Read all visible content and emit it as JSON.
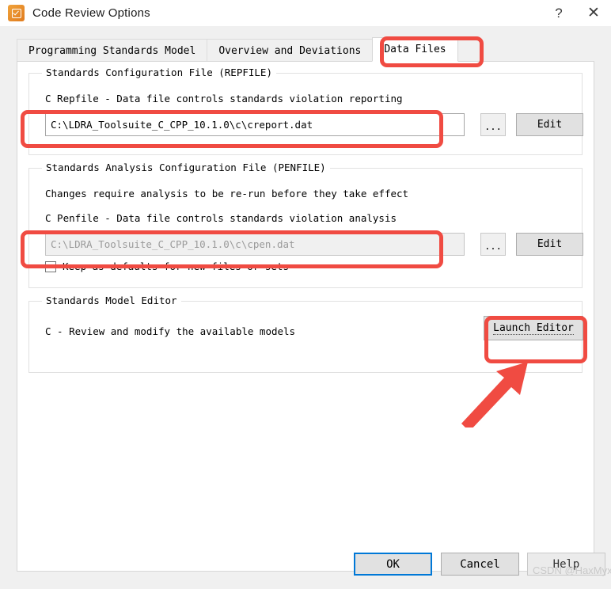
{
  "window": {
    "title": "Code Review Options",
    "icon": "checkbox-orange-icon",
    "help_label": "?",
    "close_label": "✕"
  },
  "tabs": [
    {
      "label": "Programming Standards Model",
      "selected": false
    },
    {
      "label": "Overview and Deviations",
      "selected": false
    },
    {
      "label": "Data Files",
      "selected": true
    }
  ],
  "groups": {
    "repfile": {
      "legend": "Standards Configuration File (REPFILE)",
      "description": "C Repfile - Data file controls standards violation reporting",
      "path_value": "C:\\LDRA_Toolsuite_C_CPP_10.1.0\\c\\creport.dat",
      "browse_label": "...",
      "edit_label": "Edit"
    },
    "penfile": {
      "legend": "Standards Analysis Configuration File (PENFILE)",
      "note": "Changes require analysis to be re-run before they take effect",
      "description": "C Penfile - Data file controls standards violation analysis",
      "path_value": "C:\\LDRA_Toolsuite_C_CPP_10.1.0\\c\\cpen.dat",
      "browse_label": "...",
      "edit_label": "Edit",
      "keep_defaults_label": "Keep as defaults for new files or sets",
      "keep_defaults_checked": false
    },
    "model_editor": {
      "legend": "Standards Model Editor",
      "description": "C - Review and modify the available models",
      "launch_label": "Launch Editor"
    }
  },
  "footer": {
    "ok_label": "OK",
    "cancel_label": "Cancel",
    "help_label": "Help"
  },
  "watermark": {
    "text": "CSDN @HaxMyx"
  },
  "colors": {
    "annotation": "#f04b42",
    "default_button_outline": "#0078d7",
    "app_icon": "#e07b1e"
  }
}
